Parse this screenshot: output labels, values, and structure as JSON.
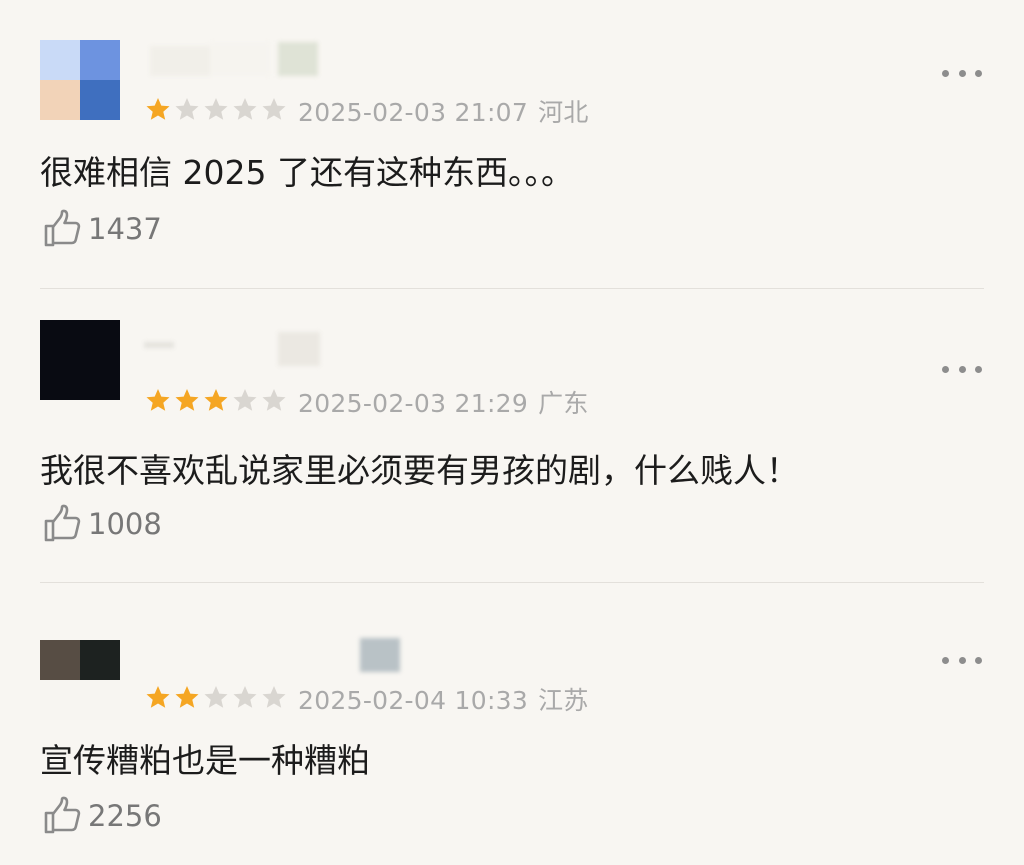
{
  "colors": {
    "star_filled": "#f5a623",
    "star_empty": "#d9d6d1",
    "meta": "#a9a9a9",
    "background": "#f8f6f2"
  },
  "reviews": [
    {
      "rating": 1,
      "date": "2025-02-03 21:07",
      "location": "河北",
      "text": "很难相信 2025 了还有这种东西。。。",
      "likes": "1437"
    },
    {
      "rating": 3,
      "date": "2025-02-03 21:29",
      "location": "广东",
      "text": "我很不喜欢乱说家里必须要有男孩的剧，什么贱人！",
      "likes": "1008"
    },
    {
      "rating": 2,
      "date": "2025-02-04 10:33",
      "location": "江苏",
      "text": "宣传糟粕也是一种糟粕",
      "likes": "2256"
    }
  ],
  "icons": {
    "more": "more-horizontal-icon",
    "like": "thumbs-up-icon",
    "star": "star-icon"
  }
}
